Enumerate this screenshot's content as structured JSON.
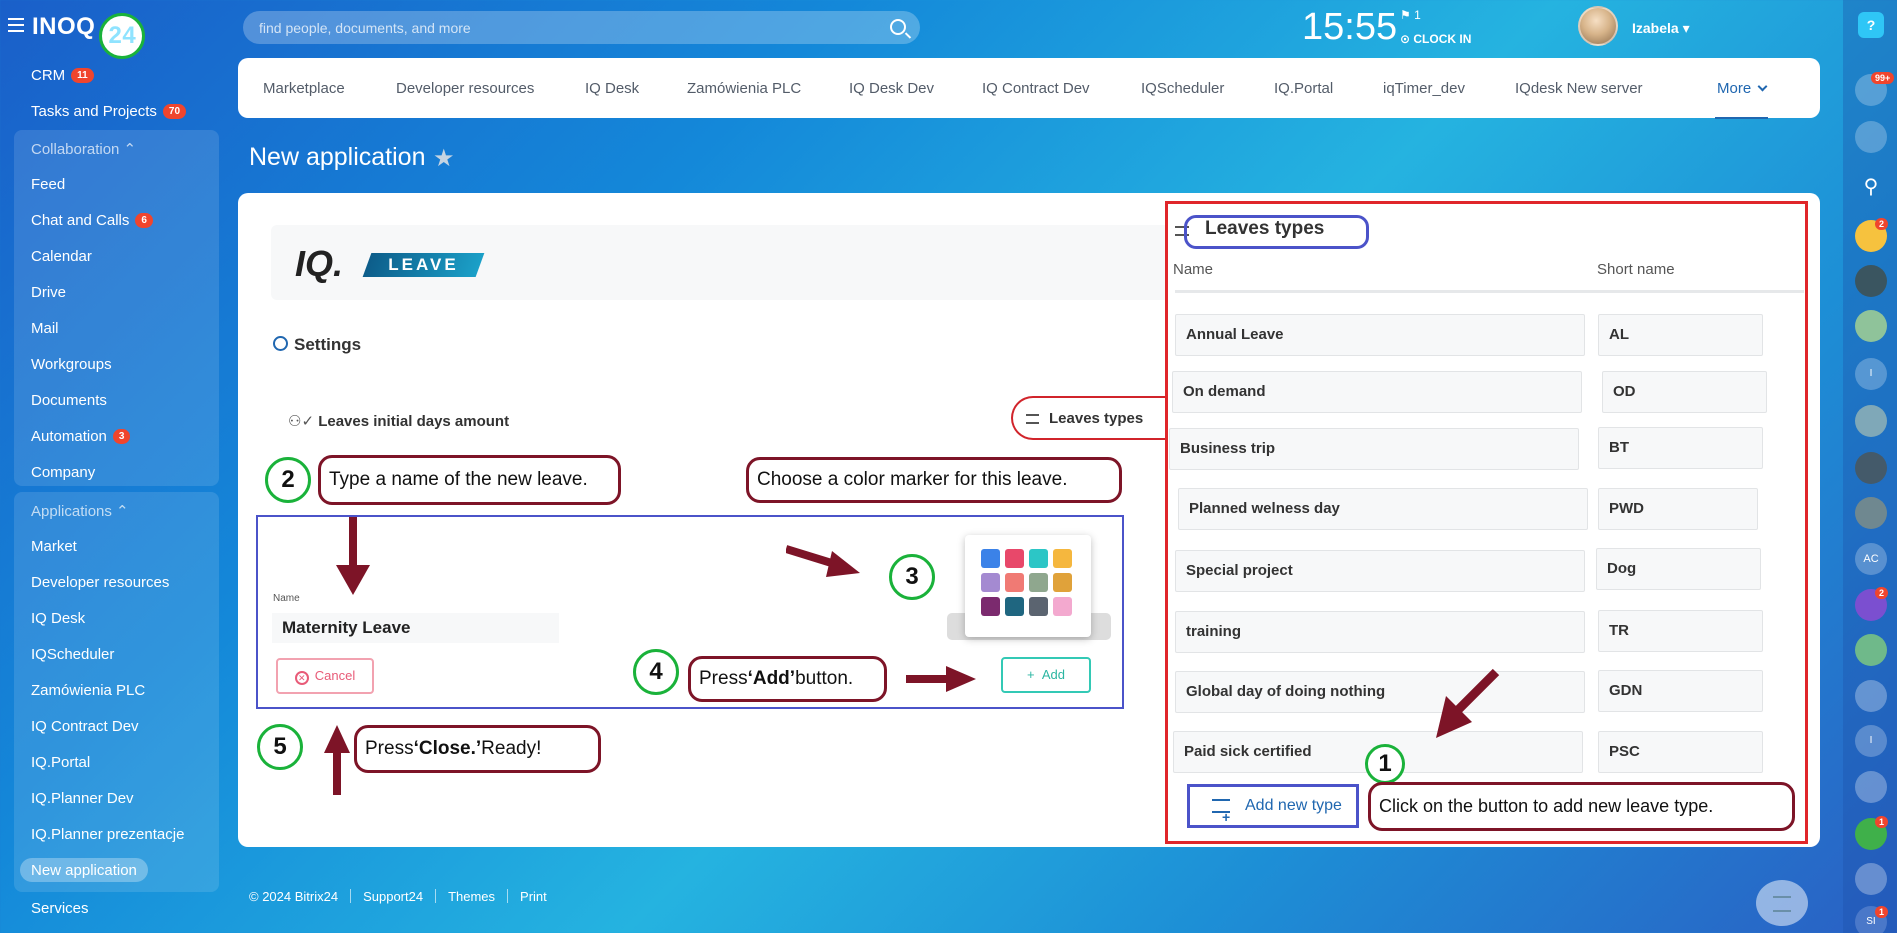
{
  "header": {
    "logo_main": "INOQ",
    "logo_num": "24",
    "search_placeholder": "find people, documents, and more",
    "time": "15:55",
    "flag_count": "1",
    "clock_in": "CLOCK IN",
    "user_name": "Izabela"
  },
  "sidebar": {
    "crm": {
      "label": "CRM",
      "badge": "11"
    },
    "tasks": {
      "label": "Tasks and Projects",
      "badge": "70"
    },
    "collaboration": "Collaboration",
    "feed": "Feed",
    "chat": {
      "label": "Chat and Calls",
      "badge": "6"
    },
    "calendar": "Calendar",
    "drive": "Drive",
    "mail": "Mail",
    "workgroups": "Workgroups",
    "documents": "Documents",
    "automation": {
      "label": "Automation",
      "badge": "3"
    },
    "company": "Company",
    "applications": "Applications",
    "market": "Market",
    "devres": "Developer resources",
    "iqdesk": "IQ Desk",
    "iqscheduler": "IQScheduler",
    "zamowienia": "Zamówienia PLC",
    "iqcontract": "IQ Contract Dev",
    "iqportal": "IQ.Portal",
    "iqplanner": "IQ.Planner Dev",
    "iqplanner_prez": "IQ.Planner prezentacje",
    "newapp": "New application",
    "services": "Services"
  },
  "tabs": [
    "Marketplace",
    "Developer resources",
    "IQ Desk",
    "Zamówienia PLC",
    "IQ Desk Dev",
    "IQ Contract Dev",
    "IQScheduler",
    "IQ.Portal",
    "iqTimer_dev",
    "IQdesk New server",
    "More"
  ],
  "page": {
    "title": "New application",
    "star": "★"
  },
  "app": {
    "logo_iq": "IQ.",
    "logo_leave": "LEAVE",
    "settings": "Settings",
    "leaves_initial": "Leaves initial days amount",
    "leaves_types_tab": "Leaves types",
    "name_label": "Name",
    "name_value": "Maternity Leave",
    "cancel": "Cancel",
    "add": "Add",
    "palette_colors": [
      "#3b82e8",
      "#e8486a",
      "#2cc6c6",
      "#f5b73e",
      "#a48ad1",
      "#f07a74",
      "#8fa78e",
      "#e0a23a",
      "#7b2a6e",
      "#1f6680",
      "#5b6470",
      "#f3a9cf"
    ]
  },
  "callouts": {
    "c1": "Click on the button to add new leave type.",
    "c2": "Type a name of the new leave.",
    "c3": "Choose a color marker for this leave.",
    "c4_pre": "Press ",
    "c4_bold": "‘Add’",
    "c4_post": " button.",
    "c5_pre": "Press ",
    "c5_bold": "‘Close.’",
    "c5_post": " Ready!",
    "n1": "1",
    "n2": "2",
    "n3": "3",
    "n4": "4",
    "n5": "5"
  },
  "leaves": {
    "title": "Leaves types",
    "col_name": "Name",
    "col_short": "Short name",
    "rows": [
      {
        "name": "Annual Leave",
        "short": "AL"
      },
      {
        "name": "On demand",
        "short": "OD"
      },
      {
        "name": "Business trip",
        "short": "BT"
      },
      {
        "name": "Planned welness day",
        "short": "PWD"
      },
      {
        "name": "Special project",
        "short": "Dog"
      },
      {
        "name": "training",
        "short": "TR"
      },
      {
        "name": "Global day of doing nothing",
        "short": "GDN"
      },
      {
        "name": "Paid  sick  certified",
        "short": "PSC"
      }
    ],
    "add_new": "Add new type"
  },
  "footer": {
    "copyright": "© 2024 Bitrix24",
    "support": "Support24",
    "themes": "Themes",
    "print": "Print"
  },
  "rail": {
    "help": "?",
    "notif_badge": "99+",
    "badge2": "2",
    "ac": "AC",
    "i": "I",
    "badge1": "1",
    "si": "SI"
  }
}
